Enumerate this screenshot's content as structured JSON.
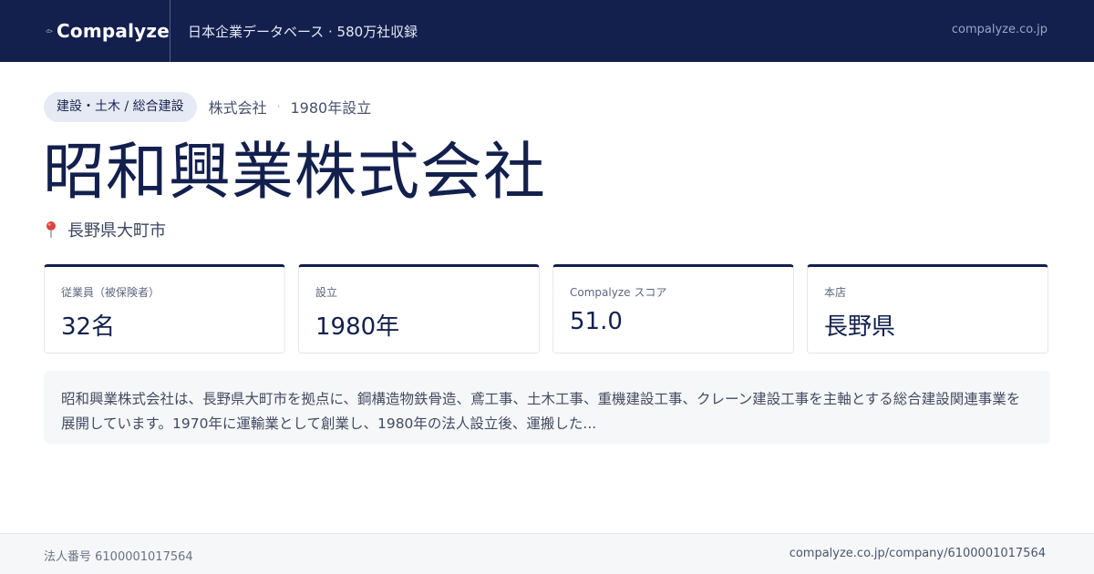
{
  "header": {
    "brand": "Compalyze",
    "tagline": "日本企業データベース · 580万社収録",
    "domain": "compalyze.co.jp",
    "background_color": "#13204e",
    "logo_icon": "bird-logo-icon"
  },
  "company": {
    "industry": "建設・土木 / 総合建設",
    "type": "株式会社",
    "separator": "·",
    "founded_text": "1980年設立",
    "name": "昭和興業株式会社",
    "location_icon": "map-pin-icon",
    "location": "長野県大町市"
  },
  "stats": [
    {
      "label": "従業員（被保険者）",
      "value": "32名"
    },
    {
      "label": "設立",
      "value": "1980年"
    },
    {
      "label": "Compalyze スコア",
      "value": "51.0"
    },
    {
      "label": "本店",
      "value": "長野県"
    }
  ],
  "description": "昭和興業株式会社は、長野県大町市を拠点に、鋼構造物鉄骨造、鳶工事、土木工事、重機建設工事、クレーン建設工事を主軸とする総合建設関連事業を展開しています。1970年に運輸業として創業し、1980年の法人設立後、運搬した...",
  "footer": {
    "corporate_number": "法人番号 6100001017564",
    "url": "compalyze.co.jp/company/6100001017564"
  },
  "colors": {
    "navy": "#13204e",
    "badge_bg": "#e6eaf4",
    "panel_bg": "#f6f7f8",
    "pin": "#e0433a"
  }
}
